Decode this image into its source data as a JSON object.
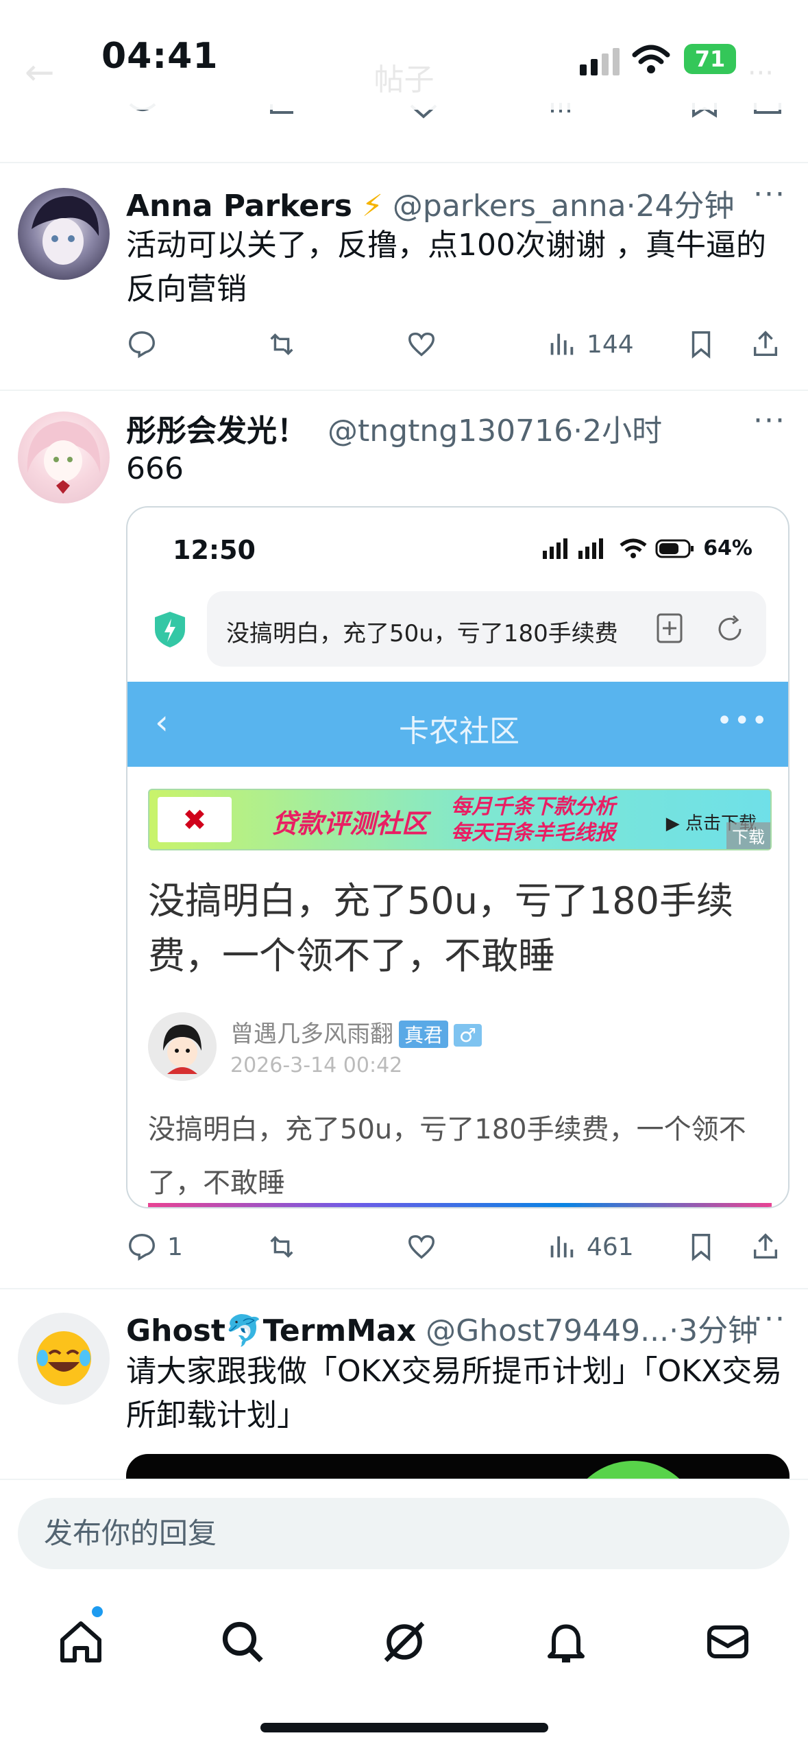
{
  "status_bar": {
    "time": "04:41",
    "battery": "71",
    "page_title": "帖子"
  },
  "tweets": [
    {
      "name": "Anna Parkers",
      "badge": "⚡",
      "handle": "@parkers_anna",
      "time": "·24分钟",
      "text": "活动可以关了，反撸，点100次谢谢 ，真牛逼的反向营销",
      "replies": "",
      "views": "144"
    },
    {
      "name": "彤彤会发光！",
      "handle": "@tngtng130716",
      "time": "·2小时",
      "text": "666",
      "replies": "1",
      "views": "461",
      "embedded": {
        "time": "12:50",
        "battery": "64%",
        "url": "没搞明白，充了50u，亏了180手续费",
        "nav_title": "卡农社区",
        "banner_title": "贷款评测社区",
        "banner_line1": "每月千条下款分析",
        "banner_line2": "每天百条羊毛线报",
        "banner_cta": "▶ 点击下载",
        "banner_download": "下载",
        "post_title": "没搞明白，充了50u，亏了180手续费，一个领不了，不敢睡",
        "author": "曾遇几多风雨翻",
        "author_badge": "真君",
        "author_gender": "♂",
        "date": "2026-3-14 00:42",
        "body": "没搞明白，充了50u，亏了180手续费，一个领不了，不敢睡"
      }
    },
    {
      "name": "Ghost",
      "name_emoji": "🐬",
      "name2": "TermMax",
      "handle": "@Ghost79449...",
      "time": "·3分钟",
      "text": "请大家跟我做「OKX交易所提币计划」「OKX交易所卸载计划」"
    }
  ],
  "reply_placeholder": "发布你的回复",
  "more_label": "···",
  "colors": {
    "accent": "#1d9bf0",
    "muted": "#536471",
    "nav_blue": "#58b4ee"
  }
}
